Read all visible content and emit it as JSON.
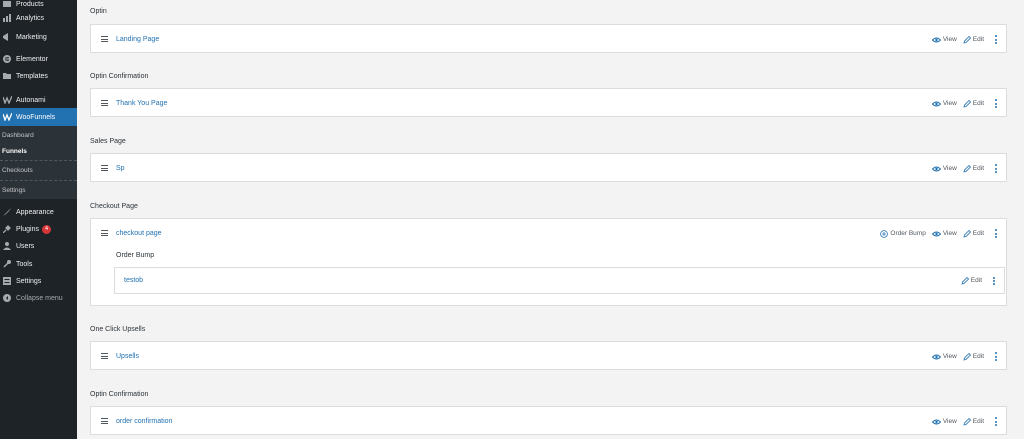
{
  "sidebar": {
    "items": [
      {
        "label": "Products",
        "icon": "products-icon"
      },
      {
        "label": "Analytics",
        "icon": "analytics-icon"
      },
      {
        "label": "Marketing",
        "icon": "marketing-icon"
      },
      {
        "label": "Elementor",
        "icon": "elementor-icon"
      },
      {
        "label": "Templates",
        "icon": "templates-icon"
      },
      {
        "label": "Autonami",
        "icon": "autonami-icon"
      },
      {
        "label": "WooFunnels",
        "icon": "woofunnels-icon"
      }
    ],
    "submenu": [
      "Dashboard",
      "Funnels",
      "Checkouts",
      "Settings"
    ],
    "bottom_items": [
      {
        "label": "Appearance",
        "icon": "appearance-icon"
      },
      {
        "label": "Plugins",
        "icon": "plugins-icon",
        "badge": "4"
      },
      {
        "label": "Users",
        "icon": "users-icon"
      },
      {
        "label": "Tools",
        "icon": "tools-icon"
      },
      {
        "label": "Settings",
        "icon": "settings-icon"
      },
      {
        "label": "Collapse menu",
        "icon": "collapse-icon"
      }
    ]
  },
  "actions": {
    "view": "View",
    "edit": "Edit",
    "order_bump": "Order Bump"
  },
  "colors": {
    "accent": "#2271b1",
    "sidebar_bg": "#1d2327",
    "badge": "#d63638"
  },
  "sections": [
    {
      "label": "Optin",
      "step": "Landing Page"
    },
    {
      "label": "Optin Confirmation",
      "step": "Thank You Page"
    },
    {
      "label": "Sales Page",
      "step": "Sp"
    },
    {
      "label": "Checkout Page",
      "step": "checkout page",
      "order_bump_title": "Order Bump",
      "order_bump_item": "testob"
    },
    {
      "label": "One Click Upsells",
      "step": "Upsells"
    },
    {
      "label": "Optin Confirmation",
      "step": "order confirmation"
    }
  ]
}
